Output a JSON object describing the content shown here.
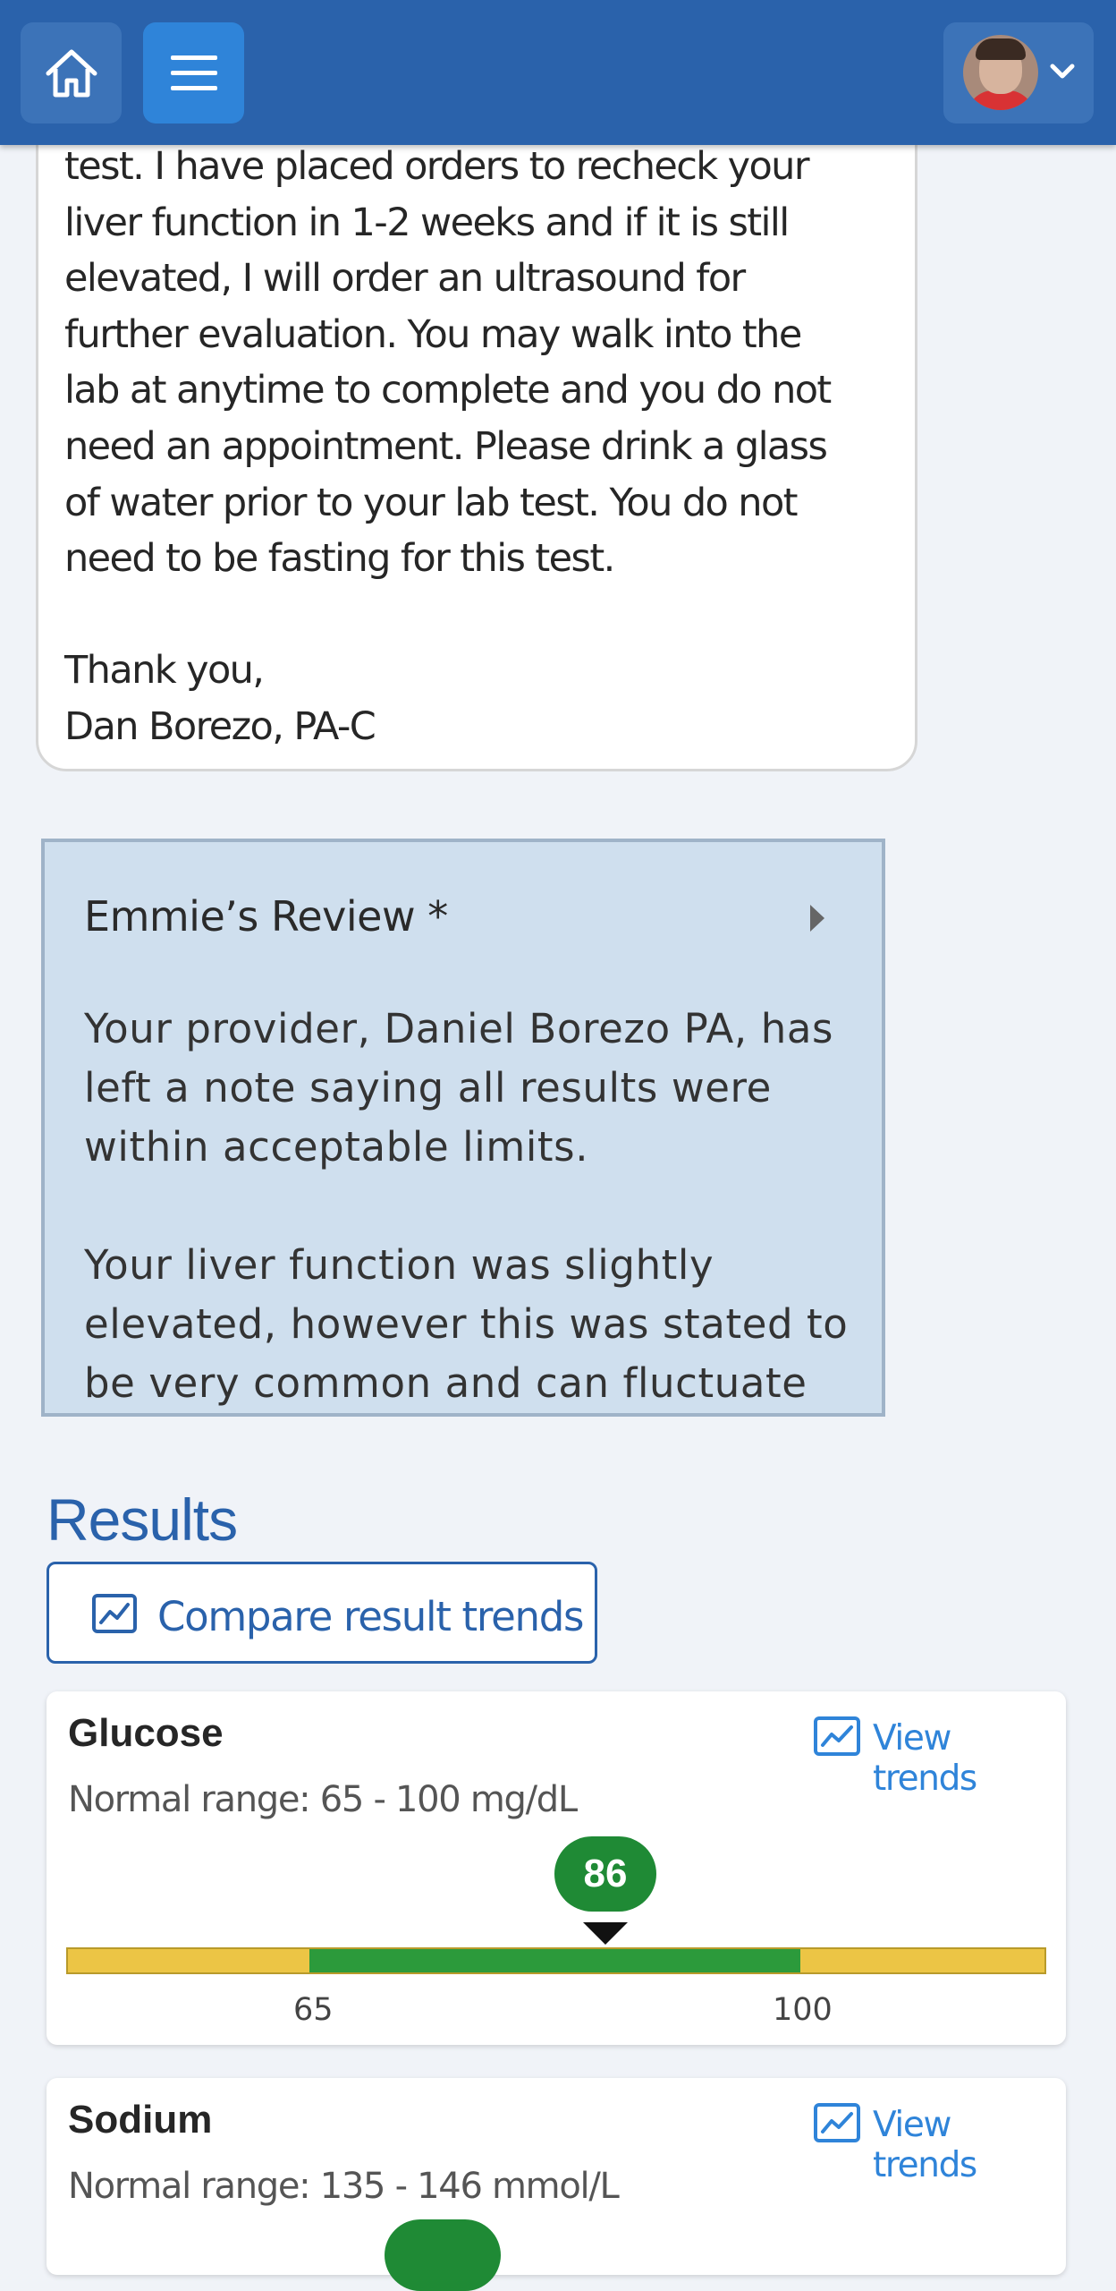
{
  "nav": {
    "home_icon": "home-icon",
    "menu_icon": "hamburger-menu-icon",
    "account_chevron_icon": "chevron-down-icon"
  },
  "message": {
    "lines": [
      "test. I have placed orders to recheck your",
      "liver function in 1-2 weeks and if it is still",
      "elevated, I will order an ultrasound for",
      "further evaluation. You may walk into the",
      "lab at anytime to complete and you do not",
      "need an appointment. Please drink a glass",
      "of water prior to your lab test. You do not",
      "need to be fasting for this test."
    ],
    "closing": "Thank you,",
    "signature": "Dan Borezo, PA-C"
  },
  "review": {
    "title": "Emmie’s Review *",
    "paragraph1": [
      "Your provider, Daniel Borezo  PA, has",
      "left a note saying all results were",
      "within acceptable limits."
    ],
    "paragraph2": [
      "Your liver function was slightly",
      "elevated, however this was stated to",
      "be very common and can fluctuate"
    ]
  },
  "results": {
    "heading": "Results",
    "compare_label": "Compare result trends",
    "items": [
      {
        "name": "Glucose",
        "trend_label": "View trends",
        "normal_range": "Normal range: 65 - 100 mg/dL",
        "value": "86",
        "low": "65",
        "high": "100"
      },
      {
        "name": "Sodium",
        "trend_label": "View trends",
        "normal_range": "Normal range: 135 - 146 mmol/L"
      }
    ]
  },
  "colors": {
    "brand_blue": "#2a62ab",
    "link_blue": "#2f84d9",
    "normal_green": "#2c9a3b",
    "out_of_range_yellow": "#ecc545"
  }
}
